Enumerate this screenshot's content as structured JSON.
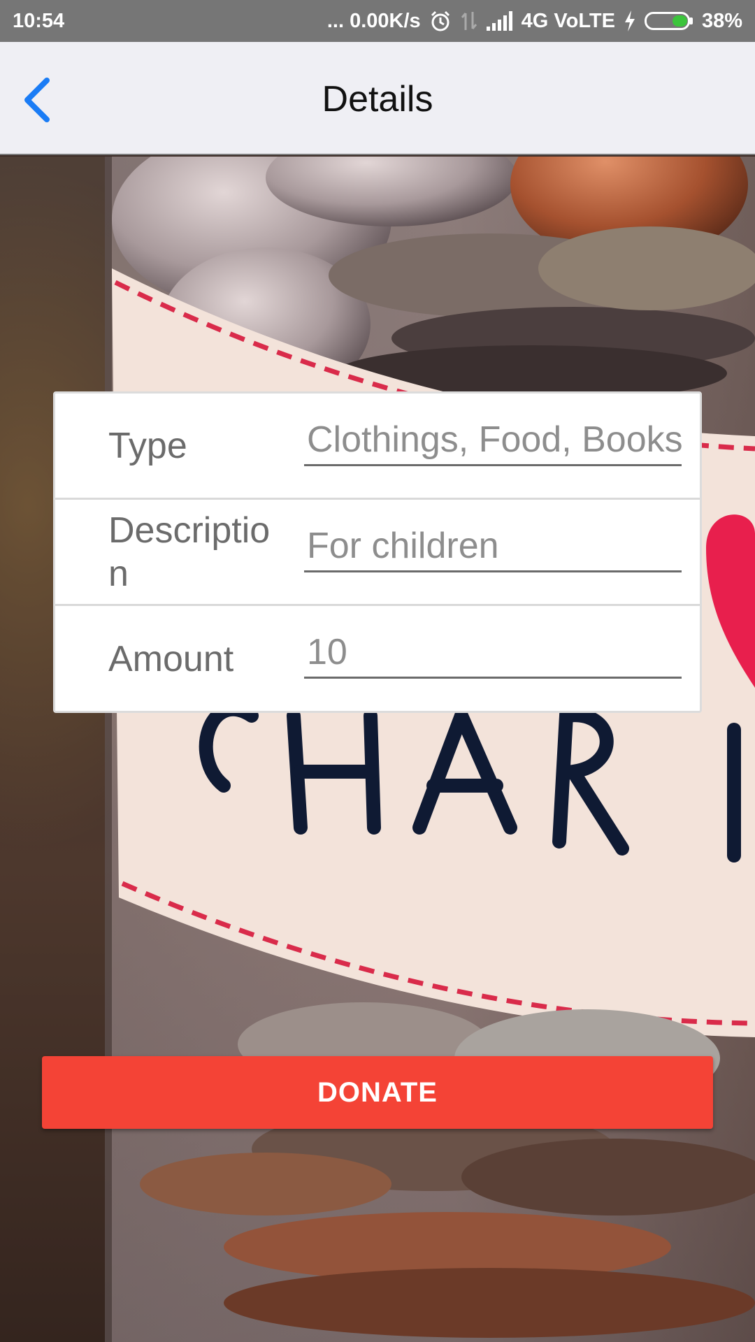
{
  "status_bar": {
    "time": "10:54",
    "network_speed": "... 0.00K/s",
    "network_type": "4G VoLTE",
    "battery_percent": "38%",
    "battery_level": 0.38,
    "icons": [
      "alarm-icon",
      "data-arrows-icon",
      "signal-icon",
      "charging-icon",
      "battery-icon"
    ]
  },
  "nav": {
    "title": "Details",
    "back_icon": "chevron-left-icon",
    "accent_color": "#1a7cf5"
  },
  "form": {
    "rows": [
      {
        "label": "Type",
        "value": "Clothings, Food, Books"
      },
      {
        "label": "Description",
        "value": "For children"
      },
      {
        "label": "Amount",
        "value": "10"
      }
    ]
  },
  "donate": {
    "label": "DONATE",
    "color": "#f44336"
  }
}
